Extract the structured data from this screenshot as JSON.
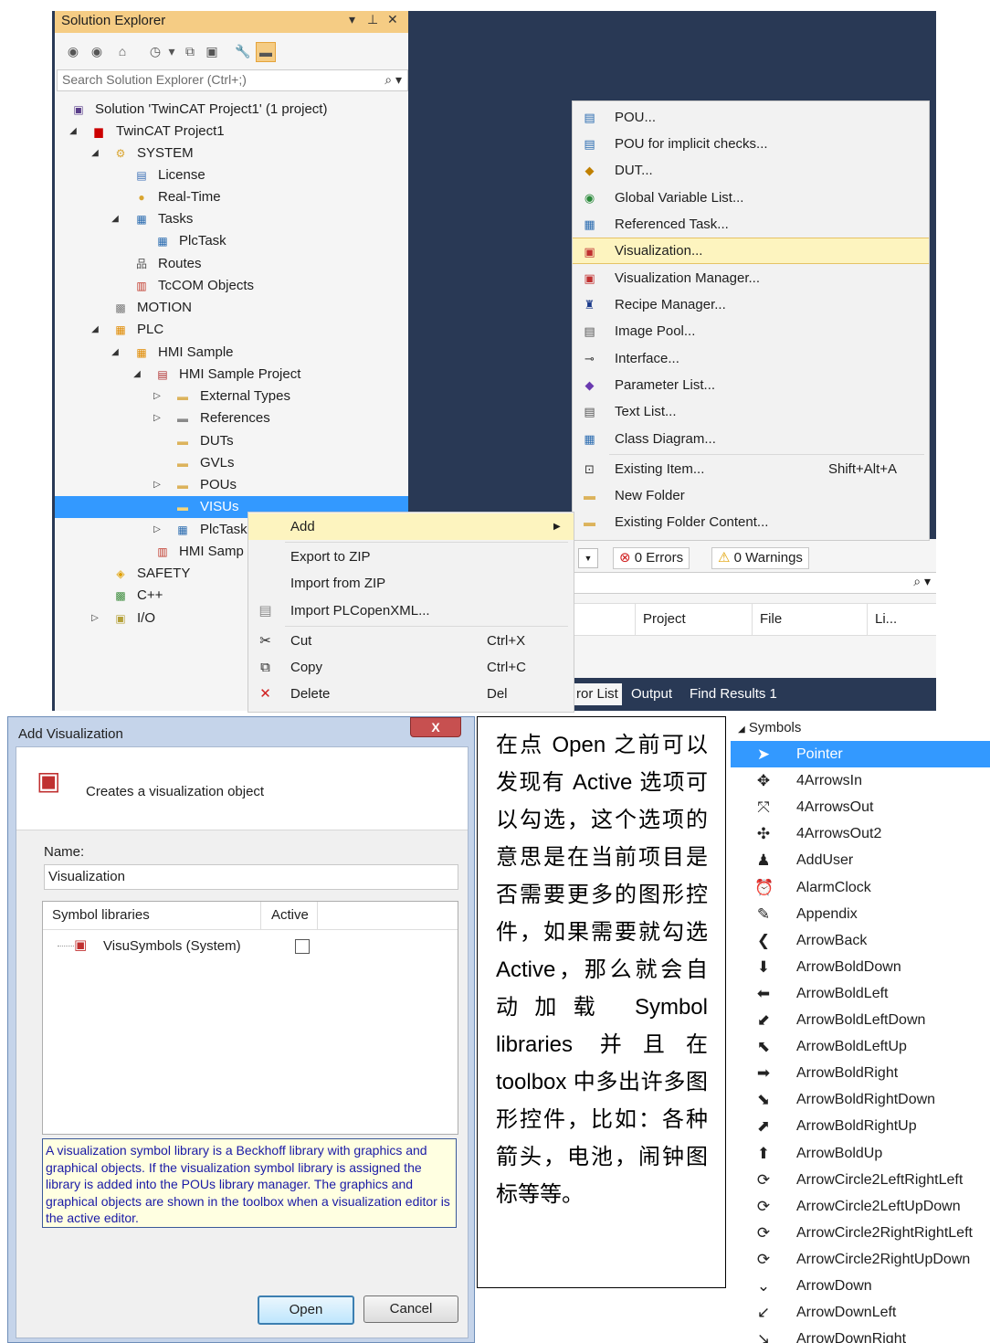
{
  "solution_explorer": {
    "title": "Solution Explorer",
    "title_controls": [
      "▾",
      "⊥",
      "✕"
    ],
    "search_placeholder": "Search Solution Explorer (Ctrl+;)",
    "tree": [
      {
        "label": "Solution 'TwinCAT Project1' (1 project)",
        "icon": "solution-icon"
      },
      {
        "label": "TwinCAT Project1",
        "icon": "project-icon"
      },
      {
        "label": "SYSTEM",
        "icon": "system-icon"
      },
      {
        "label": "License",
        "icon": "license-icon"
      },
      {
        "label": "Real-Time",
        "icon": "realtime-icon"
      },
      {
        "label": "Tasks",
        "icon": "tasks-icon"
      },
      {
        "label": "PlcTask",
        "icon": "task-icon"
      },
      {
        "label": "Routes",
        "icon": "routes-icon"
      },
      {
        "label": "TcCOM Objects",
        "icon": "tccom-icon"
      },
      {
        "label": "MOTION",
        "icon": "motion-icon"
      },
      {
        "label": "PLC",
        "icon": "plc-icon"
      },
      {
        "label": "HMI Sample",
        "icon": "plc-project-icon"
      },
      {
        "label": "HMI Sample Project",
        "icon": "plc-subproject-icon"
      },
      {
        "label": "External Types",
        "icon": "folder-icon"
      },
      {
        "label": "References",
        "icon": "references-icon"
      },
      {
        "label": "DUTs",
        "icon": "folder-icon"
      },
      {
        "label": "GVLs",
        "icon": "folder-icon"
      },
      {
        "label": "POUs",
        "icon": "folder-icon"
      },
      {
        "label": "VISUs",
        "icon": "folder-icon"
      },
      {
        "label": "PlcTask",
        "icon": "plctask-icon"
      },
      {
        "label": "HMI Samp",
        "icon": "tmc-icon"
      },
      {
        "label": "SAFETY",
        "icon": "safety-icon"
      },
      {
        "label": "C++",
        "icon": "cpp-icon"
      },
      {
        "label": "I/O",
        "icon": "io-icon"
      }
    ]
  },
  "add_submenu": {
    "items": [
      {
        "label": "POU...",
        "icon": "pou-icon"
      },
      {
        "label": "POU for implicit checks...",
        "icon": "pou-checks-icon"
      },
      {
        "label": "DUT...",
        "icon": "dut-icon"
      },
      {
        "label": "Global Variable List...",
        "icon": "globe-icon"
      },
      {
        "label": "Referenced Task...",
        "icon": "task-ref-icon"
      },
      {
        "label": "Visualization...",
        "icon": "visualization-icon"
      },
      {
        "label": "Visualization Manager...",
        "icon": "vis-manager-icon"
      },
      {
        "label": "Recipe Manager...",
        "icon": "recipe-icon"
      },
      {
        "label": "Image Pool...",
        "icon": "image-pool-icon"
      },
      {
        "label": "Interface...",
        "icon": "interface-icon"
      },
      {
        "label": "Parameter List...",
        "icon": "parameter-icon"
      },
      {
        "label": "Text List...",
        "icon": "text-list-icon"
      },
      {
        "label": "Class Diagram...",
        "icon": "class-diagram-icon"
      }
    ],
    "existing_item": {
      "label": "Existing Item...",
      "shortcut": "Shift+Alt+A"
    },
    "new_folder": "New Folder",
    "existing_folder": "Existing Folder Content..."
  },
  "context_menu": {
    "add": "Add",
    "export_zip": "Export to ZIP",
    "import_zip": "Import from ZIP",
    "import_plcopen": "Import PLCopenXML...",
    "cut": {
      "label": "Cut",
      "shortcut": "Ctrl+X"
    },
    "copy": {
      "label": "Copy",
      "shortcut": "Ctrl+C"
    },
    "delete": {
      "label": "Delete",
      "shortcut": "Del"
    }
  },
  "error_list": {
    "errors": "0 Errors",
    "warnings": "0 Warnings",
    "columns": [
      "Project",
      "File",
      "Li..."
    ],
    "tabs": [
      "ror List",
      "Output",
      "Find Results 1"
    ]
  },
  "dialog": {
    "title": "Add Visualization",
    "close": "X",
    "header": "Creates a visualization object",
    "name_label": "Name:",
    "name_value": "Visualization",
    "col_libraries": "Symbol libraries",
    "col_active": "Active",
    "library": "VisuSymbols (System)",
    "info": "A visualization symbol library is a Beckhoff library with graphics and graphical objects. If the visualization symbol library is assigned the library is added into the POUs library manager. The graphics and graphical objects are shown in the toolbox when a visualization editor is the active editor.",
    "open": "Open",
    "cancel": "Cancel"
  },
  "note": "在点 Open 之前可以发现有 Active 选项可以勾选，这个选项的意思是在当前项目是否需要更多的图形控件，如果需要就勾选 Active，那么就会自动加载 Symbol libraries 并且在 toolbox 中多出许多图形控件，比如：各种箭头，电池，闹钟图标等等。",
  "symbols": {
    "header": "Symbols",
    "items": [
      {
        "label": "Pointer",
        "icon": "pointer-icon",
        "glyph": "➤"
      },
      {
        "label": "4ArrowsIn",
        "icon": "arrows-in-icon",
        "glyph": "✥"
      },
      {
        "label": "4ArrowsOut",
        "icon": "arrows-out-icon",
        "glyph": "⤧"
      },
      {
        "label": "4ArrowsOut2",
        "icon": "arrows-out2-icon",
        "glyph": "✣"
      },
      {
        "label": "AddUser",
        "icon": "add-user-icon",
        "glyph": "♟"
      },
      {
        "label": "AlarmClock",
        "icon": "alarm-clock-icon",
        "glyph": "⏰"
      },
      {
        "label": "Appendix",
        "icon": "appendix-icon",
        "glyph": "✎"
      },
      {
        "label": "ArrowBack",
        "icon": "arrow-back-icon",
        "glyph": "❮"
      },
      {
        "label": "ArrowBoldDown",
        "icon": "arrow-bold-down-icon",
        "glyph": "⬇"
      },
      {
        "label": "ArrowBoldLeft",
        "icon": "arrow-bold-left-icon",
        "glyph": "⬅"
      },
      {
        "label": "ArrowBoldLeftDown",
        "icon": "arrow-bold-left-down-icon",
        "glyph": "⬋"
      },
      {
        "label": "ArrowBoldLeftUp",
        "icon": "arrow-bold-left-up-icon",
        "glyph": "⬉"
      },
      {
        "label": "ArrowBoldRight",
        "icon": "arrow-bold-right-icon",
        "glyph": "➡"
      },
      {
        "label": "ArrowBoldRightDown",
        "icon": "arrow-bold-right-down-icon",
        "glyph": "⬊"
      },
      {
        "label": "ArrowBoldRightUp",
        "icon": "arrow-bold-right-up-icon",
        "glyph": "⬈"
      },
      {
        "label": "ArrowBoldUp",
        "icon": "arrow-bold-up-icon",
        "glyph": "⬆"
      },
      {
        "label": "ArrowCircle2LeftRightLeft",
        "icon": "arrow-circle-icon",
        "glyph": "⟳"
      },
      {
        "label": "ArrowCircle2LeftUpDown",
        "icon": "arrow-circle-icon",
        "glyph": "⟳"
      },
      {
        "label": "ArrowCircle2RightRightLeft",
        "icon": "arrow-circle-icon",
        "glyph": "⟳"
      },
      {
        "label": "ArrowCircle2RightUpDown",
        "icon": "arrow-circle-icon",
        "glyph": "⟳"
      },
      {
        "label": "ArrowDown",
        "icon": "arrow-down-icon",
        "glyph": "⌄"
      },
      {
        "label": "ArrowDownLeft",
        "icon": "arrow-down-left-icon",
        "glyph": "↙"
      },
      {
        "label": "ArrowDownRight",
        "icon": "arrow-down-right-icon",
        "glyph": "↘"
      }
    ]
  }
}
